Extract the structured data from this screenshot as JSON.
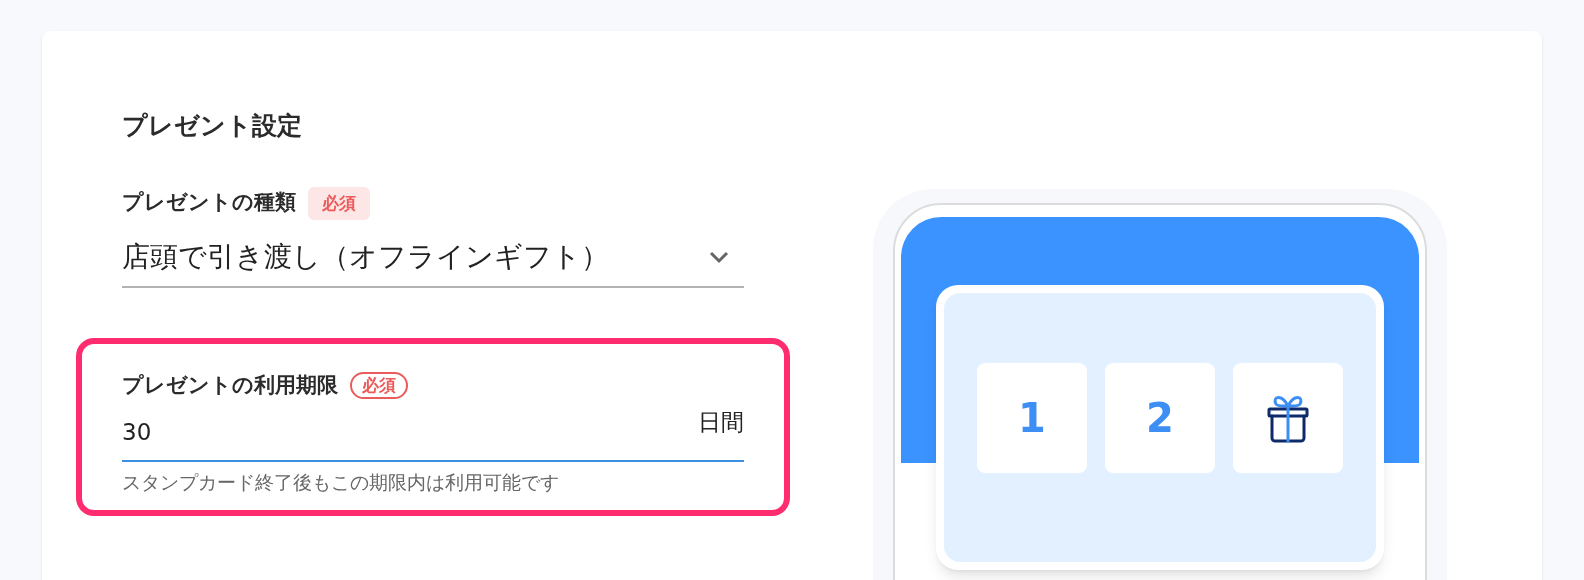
{
  "section_title": "プレゼント設定",
  "fields": [
    {
      "kind": "select",
      "label": "プレゼントの種類",
      "required": {
        "text": "必須",
        "kind": "filled"
      },
      "value": "店頭で引き渡し（オフラインギフト）",
      "highlighted": false
    },
    {
      "kind": "number",
      "label": "プレゼントの利用期限",
      "required": {
        "text": "必須",
        "kind": "outlined"
      },
      "value": "30",
      "unit": "日間",
      "help": "スタンプカード終了後もこの期限内は利用可能です",
      "highlighted": true
    }
  ],
  "preview": {
    "stamps": [
      {
        "kind": "number",
        "text": "1"
      },
      {
        "kind": "number",
        "text": "2"
      },
      {
        "kind": "gift"
      }
    ]
  }
}
